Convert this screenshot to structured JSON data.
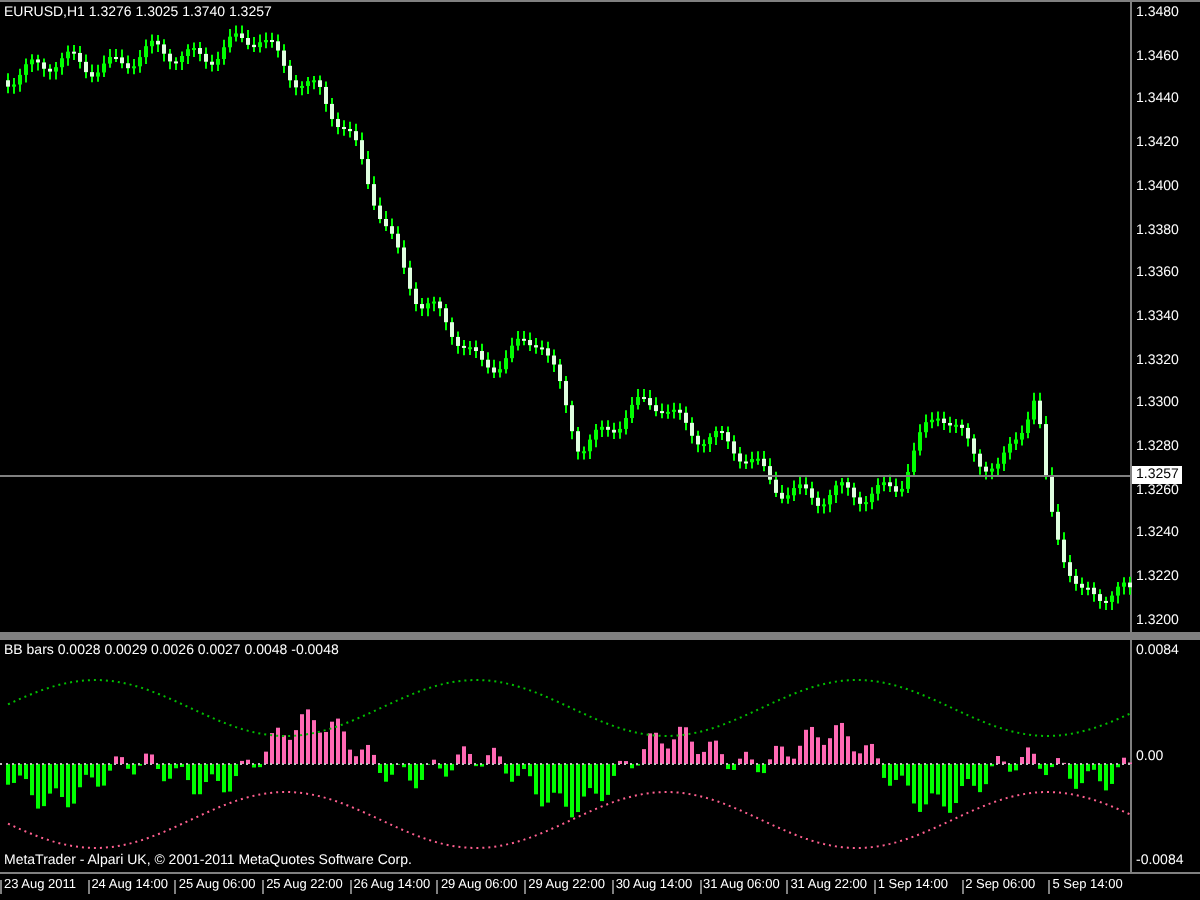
{
  "main_chart": {
    "title": "EURUSD,H1 1.3276 1.3025 1.3740 1.3257",
    "price_axis": [
      "1.3480",
      "1.3460",
      "1.3440",
      "1.3420",
      "1.3400",
      "1.3380",
      "1.3360",
      "1.3340",
      "1.3320",
      "1.3300",
      "1.3280",
      "1.3260",
      "1.3240",
      "1.3220",
      "1.3200"
    ],
    "current_price": "1.3257"
  },
  "indicator": {
    "title": "BB bars 0.0028 0.0029 0.0026 0.0027 0.0048 -0.0048",
    "axis": [
      "0.0084",
      "0.00",
      "-0.0084"
    ]
  },
  "copyright": "MetaTrader - Alpari UK, © 2001-2011 MetaQuotes Software Corp.",
  "time_axis": [
    "23 Aug 2011",
    "24 Aug 14:00",
    "25 Aug 06:00",
    "25 Aug 22:00",
    "26 Aug 14:00",
    "29 Aug 06:00",
    "29 Aug 22:00",
    "30 Aug 14:00",
    "31 Aug 06:00",
    "31 Aug 22:00",
    "1 Sep 14:00",
    "2 Sep 06:00",
    "5 Sep 14:00"
  ]
}
